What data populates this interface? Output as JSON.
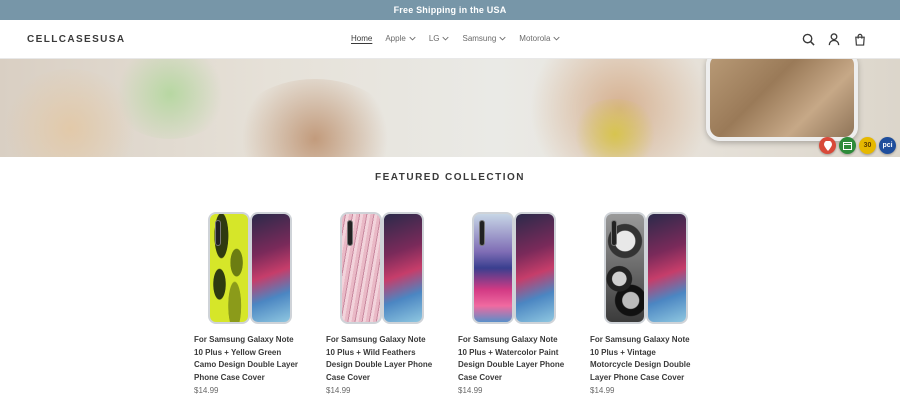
{
  "announcement": {
    "text": "Free Shipping in the USA"
  },
  "header": {
    "logo": "CELLCASESUSA",
    "nav": [
      {
        "label": "Home",
        "active": true,
        "dropdown": false
      },
      {
        "label": "Apple",
        "active": false,
        "dropdown": true
      },
      {
        "label": "LG",
        "active": false,
        "dropdown": true
      },
      {
        "label": "Samsung",
        "active": false,
        "dropdown": true
      },
      {
        "label": "Motorola",
        "active": false,
        "dropdown": true
      }
    ],
    "icons": [
      "search-icon",
      "account-icon",
      "cart-icon"
    ]
  },
  "hero": {
    "badges": [
      {
        "name": "location-pin-badge",
        "color": "#c0392b",
        "text": ""
      },
      {
        "name": "calendar-badge",
        "color": "#2e8b3a",
        "text": ""
      },
      {
        "name": "thirty-day-badge",
        "color": "#e6b800",
        "text": "30"
      },
      {
        "name": "pci-badge",
        "color": "#1f4e9c",
        "text": "pci"
      }
    ]
  },
  "featured": {
    "title": "FEATURED COLLECTION",
    "products": [
      {
        "title": "For Samsung Galaxy Note 10 Plus + Yellow Green Camo Design Double Layer Phone Case Cover",
        "price": "$14.99",
        "pattern": "camo"
      },
      {
        "title": "For Samsung Galaxy Note 10 Plus + Wild Feathers Design Double Layer Phone Case Cover",
        "price": "$14.99",
        "pattern": "feathers"
      },
      {
        "title": "For Samsung Galaxy Note 10 Plus + Watercolor Paint Design Double Layer Phone Case Cover",
        "price": "$14.99",
        "pattern": "watercolor"
      },
      {
        "title": "For Samsung Galaxy Note 10 Plus + Vintage Motorcycle Design Double Layer Phone Case Cover",
        "price": "$14.99",
        "pattern": "motorcycle"
      }
    ]
  },
  "colors": {
    "announcement_bg": "#7796a8",
    "text": "#3a3a3a",
    "muted": "#6a6a6a"
  }
}
